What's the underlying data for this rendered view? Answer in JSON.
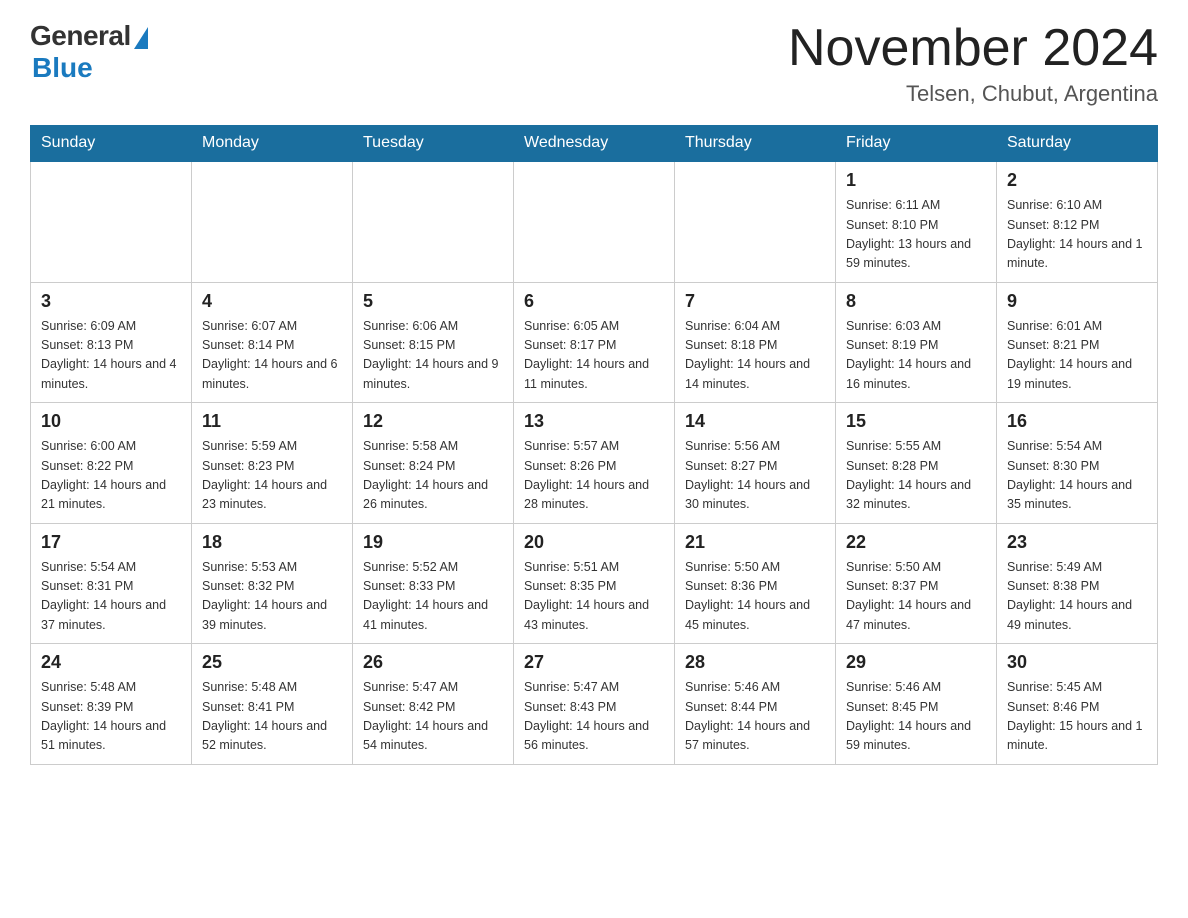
{
  "header": {
    "logo_general": "General",
    "logo_blue": "Blue",
    "month_title": "November 2024",
    "location": "Telsen, Chubut, Argentina"
  },
  "weekdays": [
    "Sunday",
    "Monday",
    "Tuesday",
    "Wednesday",
    "Thursday",
    "Friday",
    "Saturday"
  ],
  "weeks": [
    [
      {
        "day": "",
        "info": ""
      },
      {
        "day": "",
        "info": ""
      },
      {
        "day": "",
        "info": ""
      },
      {
        "day": "",
        "info": ""
      },
      {
        "day": "",
        "info": ""
      },
      {
        "day": "1",
        "info": "Sunrise: 6:11 AM\nSunset: 8:10 PM\nDaylight: 13 hours and 59 minutes."
      },
      {
        "day": "2",
        "info": "Sunrise: 6:10 AM\nSunset: 8:12 PM\nDaylight: 14 hours and 1 minute."
      }
    ],
    [
      {
        "day": "3",
        "info": "Sunrise: 6:09 AM\nSunset: 8:13 PM\nDaylight: 14 hours and 4 minutes."
      },
      {
        "day": "4",
        "info": "Sunrise: 6:07 AM\nSunset: 8:14 PM\nDaylight: 14 hours and 6 minutes."
      },
      {
        "day": "5",
        "info": "Sunrise: 6:06 AM\nSunset: 8:15 PM\nDaylight: 14 hours and 9 minutes."
      },
      {
        "day": "6",
        "info": "Sunrise: 6:05 AM\nSunset: 8:17 PM\nDaylight: 14 hours and 11 minutes."
      },
      {
        "day": "7",
        "info": "Sunrise: 6:04 AM\nSunset: 8:18 PM\nDaylight: 14 hours and 14 minutes."
      },
      {
        "day": "8",
        "info": "Sunrise: 6:03 AM\nSunset: 8:19 PM\nDaylight: 14 hours and 16 minutes."
      },
      {
        "day": "9",
        "info": "Sunrise: 6:01 AM\nSunset: 8:21 PM\nDaylight: 14 hours and 19 minutes."
      }
    ],
    [
      {
        "day": "10",
        "info": "Sunrise: 6:00 AM\nSunset: 8:22 PM\nDaylight: 14 hours and 21 minutes."
      },
      {
        "day": "11",
        "info": "Sunrise: 5:59 AM\nSunset: 8:23 PM\nDaylight: 14 hours and 23 minutes."
      },
      {
        "day": "12",
        "info": "Sunrise: 5:58 AM\nSunset: 8:24 PM\nDaylight: 14 hours and 26 minutes."
      },
      {
        "day": "13",
        "info": "Sunrise: 5:57 AM\nSunset: 8:26 PM\nDaylight: 14 hours and 28 minutes."
      },
      {
        "day": "14",
        "info": "Sunrise: 5:56 AM\nSunset: 8:27 PM\nDaylight: 14 hours and 30 minutes."
      },
      {
        "day": "15",
        "info": "Sunrise: 5:55 AM\nSunset: 8:28 PM\nDaylight: 14 hours and 32 minutes."
      },
      {
        "day": "16",
        "info": "Sunrise: 5:54 AM\nSunset: 8:30 PM\nDaylight: 14 hours and 35 minutes."
      }
    ],
    [
      {
        "day": "17",
        "info": "Sunrise: 5:54 AM\nSunset: 8:31 PM\nDaylight: 14 hours and 37 minutes."
      },
      {
        "day": "18",
        "info": "Sunrise: 5:53 AM\nSunset: 8:32 PM\nDaylight: 14 hours and 39 minutes."
      },
      {
        "day": "19",
        "info": "Sunrise: 5:52 AM\nSunset: 8:33 PM\nDaylight: 14 hours and 41 minutes."
      },
      {
        "day": "20",
        "info": "Sunrise: 5:51 AM\nSunset: 8:35 PM\nDaylight: 14 hours and 43 minutes."
      },
      {
        "day": "21",
        "info": "Sunrise: 5:50 AM\nSunset: 8:36 PM\nDaylight: 14 hours and 45 minutes."
      },
      {
        "day": "22",
        "info": "Sunrise: 5:50 AM\nSunset: 8:37 PM\nDaylight: 14 hours and 47 minutes."
      },
      {
        "day": "23",
        "info": "Sunrise: 5:49 AM\nSunset: 8:38 PM\nDaylight: 14 hours and 49 minutes."
      }
    ],
    [
      {
        "day": "24",
        "info": "Sunrise: 5:48 AM\nSunset: 8:39 PM\nDaylight: 14 hours and 51 minutes."
      },
      {
        "day": "25",
        "info": "Sunrise: 5:48 AM\nSunset: 8:41 PM\nDaylight: 14 hours and 52 minutes."
      },
      {
        "day": "26",
        "info": "Sunrise: 5:47 AM\nSunset: 8:42 PM\nDaylight: 14 hours and 54 minutes."
      },
      {
        "day": "27",
        "info": "Sunrise: 5:47 AM\nSunset: 8:43 PM\nDaylight: 14 hours and 56 minutes."
      },
      {
        "day": "28",
        "info": "Sunrise: 5:46 AM\nSunset: 8:44 PM\nDaylight: 14 hours and 57 minutes."
      },
      {
        "day": "29",
        "info": "Sunrise: 5:46 AM\nSunset: 8:45 PM\nDaylight: 14 hours and 59 minutes."
      },
      {
        "day": "30",
        "info": "Sunrise: 5:45 AM\nSunset: 8:46 PM\nDaylight: 15 hours and 1 minute."
      }
    ]
  ]
}
